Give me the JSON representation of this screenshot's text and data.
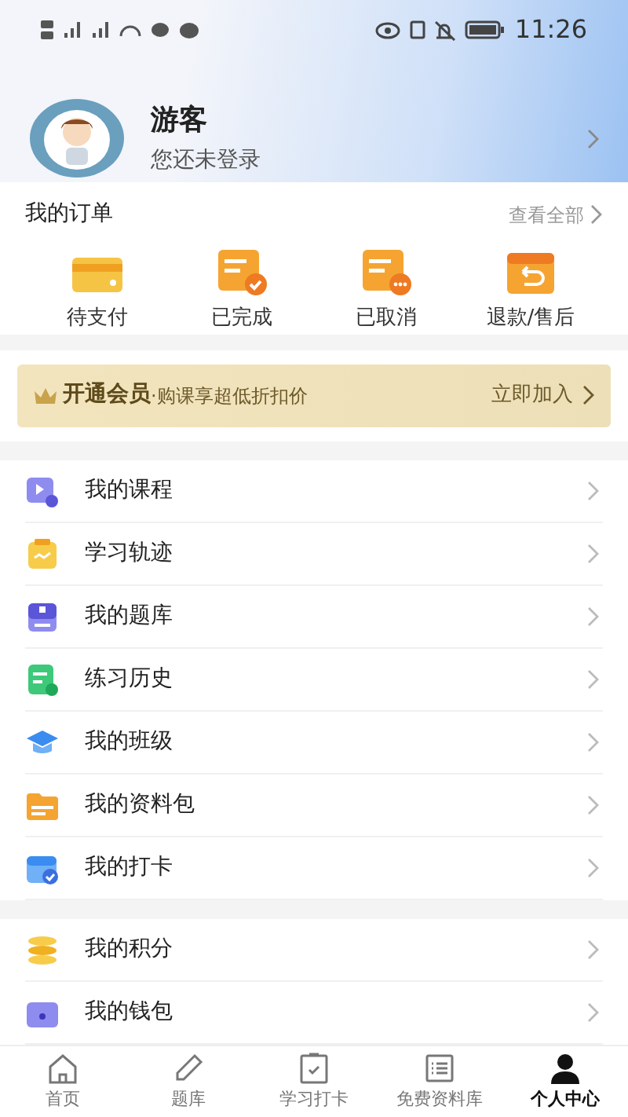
{
  "status_bar": {
    "time": "11:26"
  },
  "profile": {
    "name": "游客",
    "subtitle": "您还未登录"
  },
  "orders": {
    "title": "我的订单",
    "view_all": "查看全部",
    "items": [
      "待支付",
      "已完成",
      "已取消",
      "退款/售后"
    ]
  },
  "vip_banner": {
    "title": "开通会员",
    "subtitle": "·购课享超低折扣价",
    "action": "立即加入"
  },
  "menu_groups": [
    [
      "我的课程",
      "学习轨迹",
      "我的题库",
      "练习历史",
      "我的班级",
      "我的资料包",
      "我的打卡"
    ],
    [
      "我的积分",
      "我的钱包"
    ]
  ],
  "tab_bar": [
    {
      "label": "首页",
      "selected": false
    },
    {
      "label": "题库",
      "selected": false
    },
    {
      "label": "学习打卡",
      "selected": false
    },
    {
      "label": "免费资料库",
      "selected": false
    },
    {
      "label": "个人中心",
      "selected": true
    }
  ]
}
